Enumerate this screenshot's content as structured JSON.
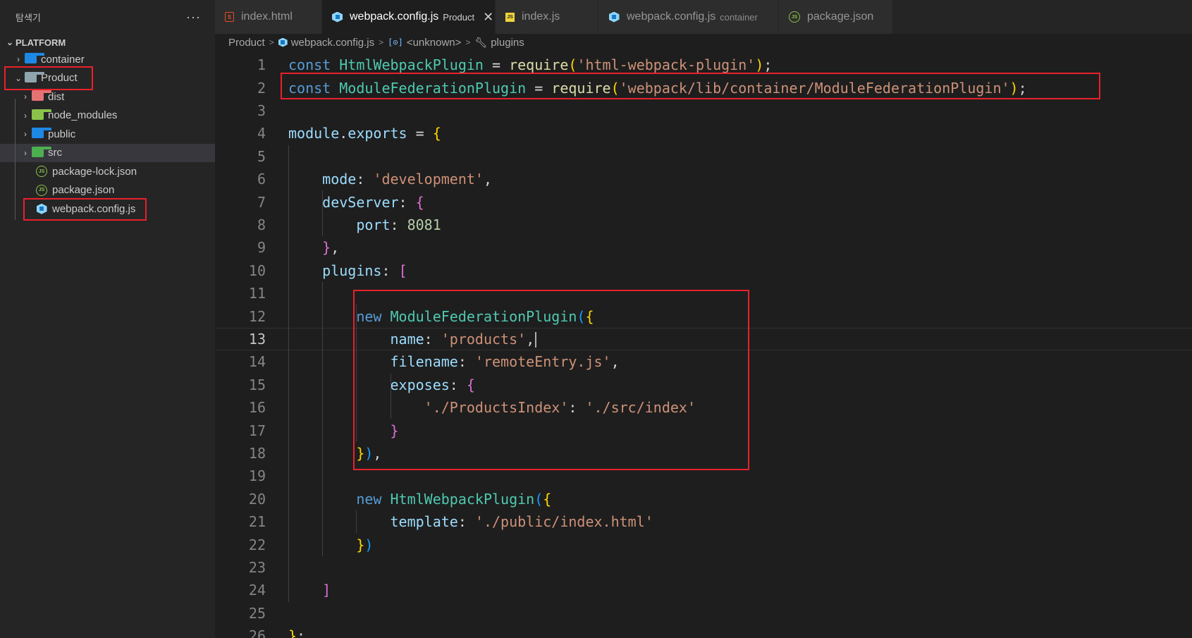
{
  "explorer": {
    "title": "탐색기",
    "more": "···",
    "root": "PLATFORM",
    "items": [
      {
        "label": "container",
        "type": "folder",
        "color": "#1e88e5"
      },
      {
        "label": "Product",
        "type": "folder-open",
        "color": "#90a4ae"
      },
      {
        "label": "dist",
        "type": "folder",
        "color": "#e57373"
      },
      {
        "label": "node_modules",
        "type": "folder",
        "color": "#8bc34a"
      },
      {
        "label": "public",
        "type": "folder",
        "color": "#1e88e5"
      },
      {
        "label": "src",
        "type": "folder",
        "color": "#4caf50"
      },
      {
        "label": "package-lock.json",
        "type": "json"
      },
      {
        "label": "package.json",
        "type": "json"
      },
      {
        "label": "webpack.config.js",
        "type": "webpack"
      }
    ]
  },
  "tabs": [
    {
      "label": "index.html",
      "icon": "html-icon",
      "desc": ""
    },
    {
      "label": "webpack.config.js",
      "icon": "webpack-icon",
      "desc": "Product",
      "close": "✕"
    },
    {
      "label": "index.js",
      "icon": "js-icon",
      "desc": ""
    },
    {
      "label": "webpack.config.js",
      "icon": "webpack-icon",
      "desc": "container"
    },
    {
      "label": "package.json",
      "icon": "node-icon",
      "desc": ""
    }
  ],
  "breadcrumb": {
    "folder": "Product",
    "file": "webpack.config.js",
    "symbol": "<unknown>",
    "prop": "plugins"
  },
  "editor": {
    "current_line": 13,
    "lines": [
      "const HtmlWebpackPlugin = require('html-webpack-plugin');",
      "const ModuleFederationPlugin = require('webpack/lib/container/ModuleFederationPlugin');",
      "",
      "module.exports = {",
      "",
      "    mode: 'development',",
      "    devServer: {",
      "        port: 8081",
      "    },",
      "    plugins: [",
      "",
      "        new ModuleFederationPlugin({",
      "            name: 'products',",
      "            filename: 'remoteEntry.js',",
      "            exposes: {",
      "                './ProductsIndex': './src/index'",
      "            }",
      "        }),",
      "",
      "        new HtmlWebpackPlugin({",
      "            template: './public/index.html'",
      "        })",
      "",
      "    ]",
      "",
      "};"
    ]
  }
}
